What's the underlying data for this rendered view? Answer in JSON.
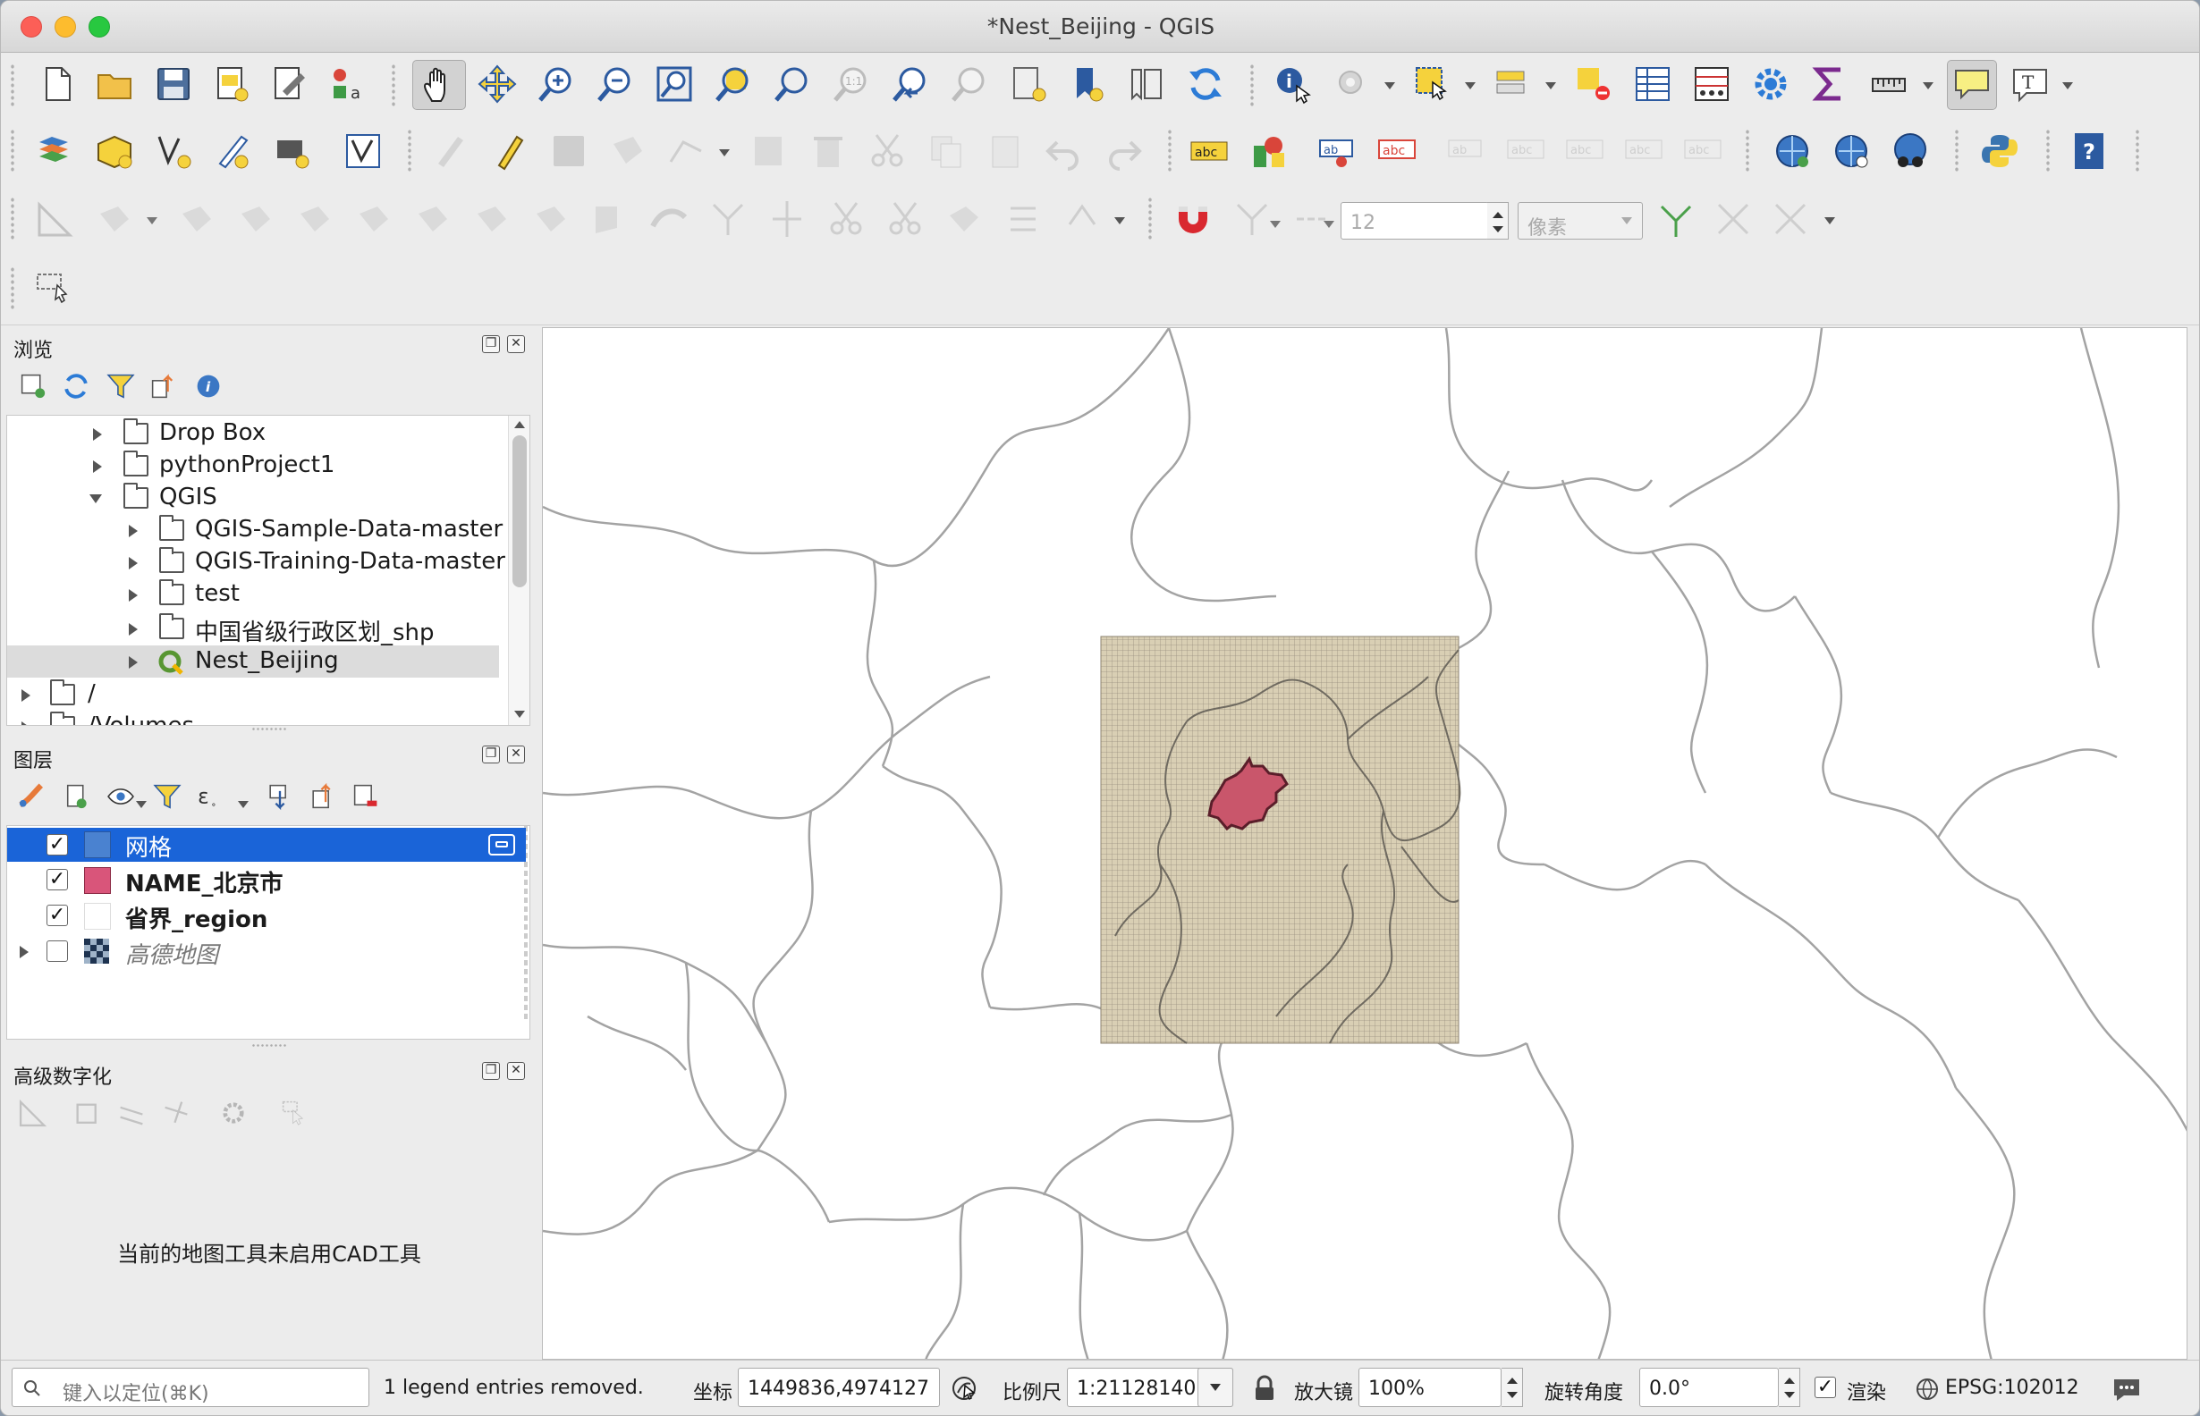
{
  "window": {
    "title": "*Nest_Beijing - QGIS"
  },
  "toolbar": {
    "snap_tolerance_value": "12",
    "snap_unit": "像素"
  },
  "browser_panel": {
    "title": "浏览",
    "items": [
      {
        "label": "Drop Box",
        "level": 2,
        "expanded": false
      },
      {
        "label": "pythonProject1",
        "level": 2,
        "expanded": false
      },
      {
        "label": "QGIS",
        "level": 2,
        "expanded": true
      },
      {
        "label": "QGIS-Sample-Data-master",
        "level": 3,
        "expanded": false
      },
      {
        "label": "QGIS-Training-Data-master",
        "level": 3,
        "expanded": false
      },
      {
        "label": "test",
        "level": 3,
        "expanded": false
      },
      {
        "label": "中国省级行政区划_shp",
        "level": 3,
        "expanded": false
      },
      {
        "label": "Nest_Beijing",
        "level": 3,
        "expanded": false,
        "selected": true,
        "type": "qgis-project"
      },
      {
        "label": "/",
        "level": 1,
        "expanded": false
      },
      {
        "label": "/Volumes",
        "level": 1,
        "expanded": false
      }
    ]
  },
  "layers_panel": {
    "title": "图层",
    "layers": [
      {
        "name": "网格",
        "checked": true,
        "selected": true,
        "color": "#4a82d0"
      },
      {
        "name": "NAME_北京市",
        "checked": true,
        "color": "#d9557a"
      },
      {
        "name": "省界_region",
        "checked": true,
        "color": "#ffffff"
      },
      {
        "name": "高德地图",
        "checked": false,
        "italic": true,
        "color": "raster"
      }
    ]
  },
  "cad_panel": {
    "title": "高级数字化",
    "message": "当前的地图工具未启用CAD工具"
  },
  "statusbar": {
    "search_placeholder": "键入以定位(⌘K)",
    "message": "1 legend entries removed.",
    "coord_label": "坐标",
    "coord_value": "1449836,4974127",
    "scale_label": "比例尺",
    "scale_value": "1:21128140",
    "magnifier_label": "放大镜",
    "magnifier_value": "100%",
    "rotation_label": "旋转角度",
    "rotation_value": "0.0°",
    "render_label": "渲染",
    "crs": "EPSG:102012"
  },
  "colors": {
    "selection": "#1a64d8",
    "grid_fill": "#d9cfb4",
    "beijing_fill": "#c9566b",
    "accent_yellow": "#f5d23c"
  }
}
